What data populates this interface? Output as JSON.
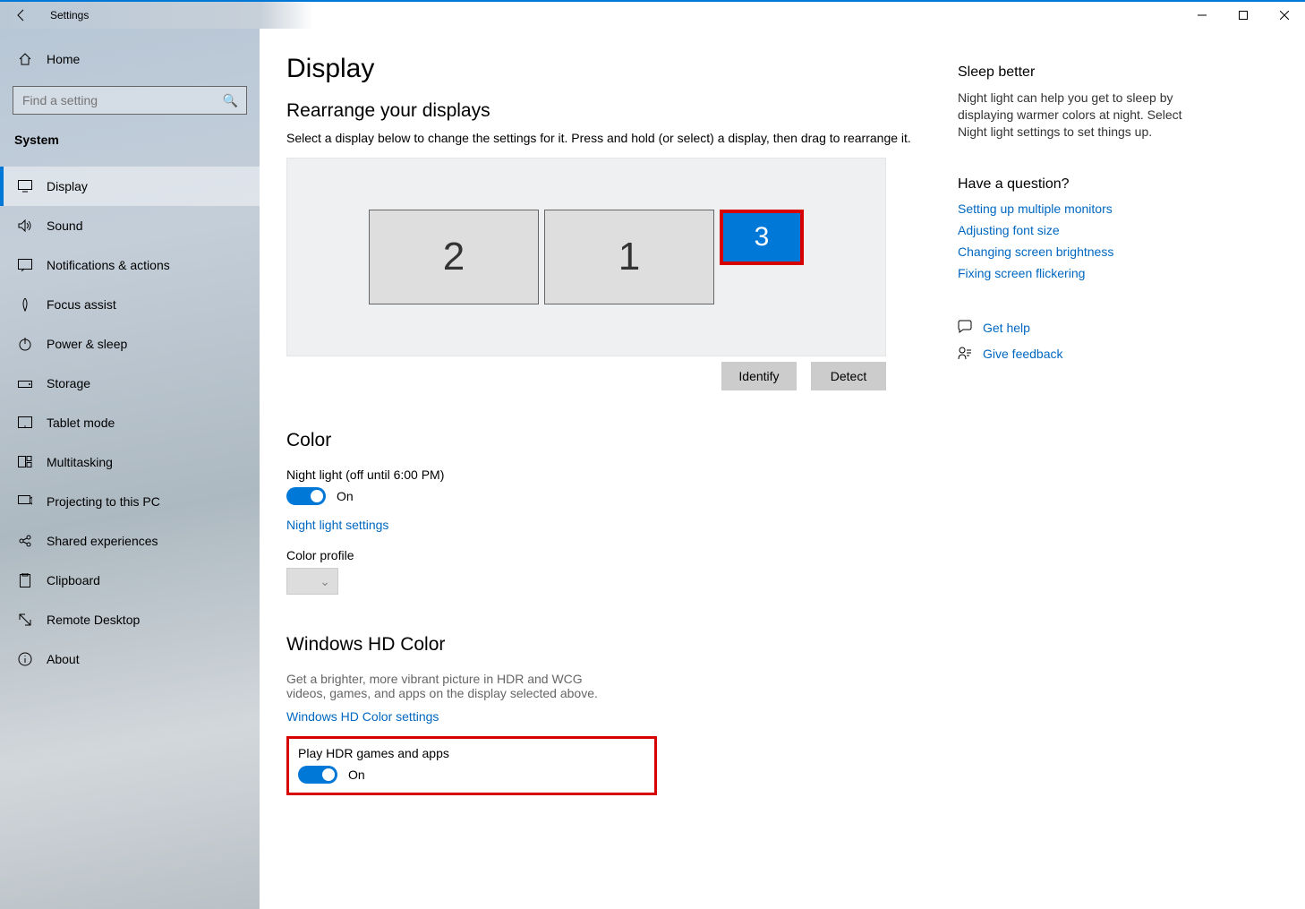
{
  "window": {
    "title": "Settings"
  },
  "sidebar": {
    "home": "Home",
    "search_placeholder": "Find a setting",
    "category": "System",
    "items": [
      {
        "label": "Display"
      },
      {
        "label": "Sound"
      },
      {
        "label": "Notifications & actions"
      },
      {
        "label": "Focus assist"
      },
      {
        "label": "Power & sleep"
      },
      {
        "label": "Storage"
      },
      {
        "label": "Tablet mode"
      },
      {
        "label": "Multitasking"
      },
      {
        "label": "Projecting to this PC"
      },
      {
        "label": "Shared experiences"
      },
      {
        "label": "Clipboard"
      },
      {
        "label": "Remote Desktop"
      },
      {
        "label": "About"
      }
    ]
  },
  "main": {
    "title": "Display",
    "rearrange": {
      "heading": "Rearrange your displays",
      "desc": "Select a display below to change the settings for it. Press and hold (or select) a display, then drag to rearrange it.",
      "monitors": {
        "one": "1",
        "two": "2",
        "three": "3"
      },
      "identify": "Identify",
      "detect": "Detect"
    },
    "color": {
      "heading": "Color",
      "nightlight_label": "Night light (off until 6:00 PM)",
      "nightlight_state": "On",
      "nightlight_settings": "Night light settings",
      "profile_label": "Color profile"
    },
    "hd": {
      "heading": "Windows HD Color",
      "desc": "Get a brighter, more vibrant picture in HDR and WCG videos, games, and apps on the display selected above.",
      "settings_link": "Windows HD Color settings",
      "play_label": "Play HDR games and apps",
      "play_state": "On"
    }
  },
  "aside": {
    "sleep": {
      "heading": "Sleep better",
      "text": "Night light can help you get to sleep by displaying warmer colors at night. Select Night light settings to set things up."
    },
    "question": "Have a question?",
    "links": [
      "Setting up multiple monitors",
      "Adjusting font size",
      "Changing screen brightness",
      "Fixing screen flickering"
    ],
    "get_help": "Get help",
    "give_feedback": "Give feedback"
  }
}
